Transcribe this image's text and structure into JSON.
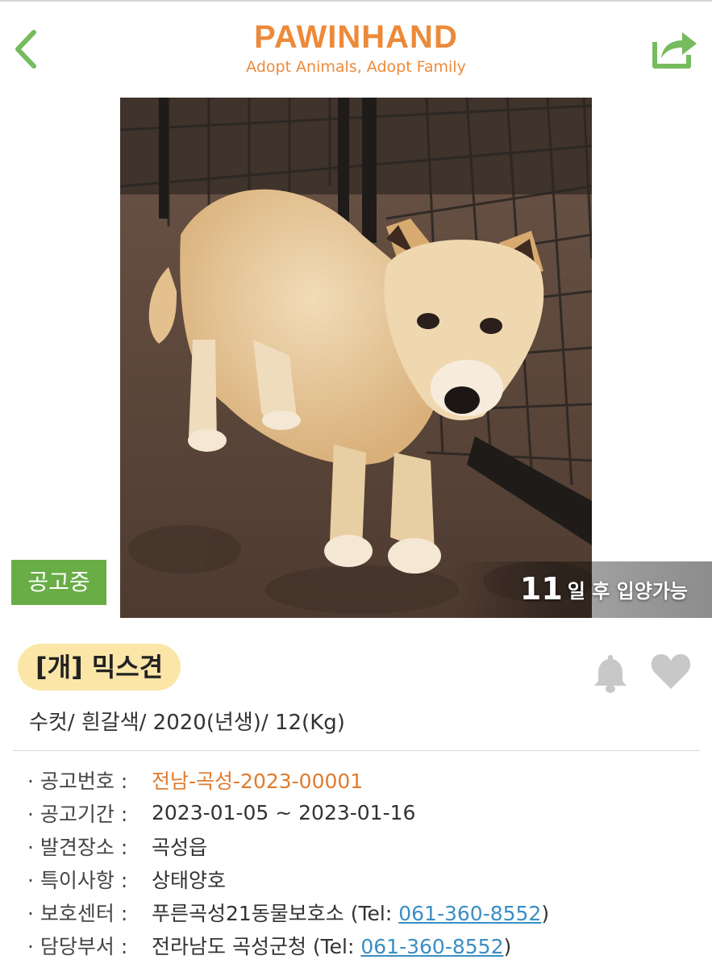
{
  "header": {
    "brand": "PAWINHAND",
    "tagline": "Adopt Animals, Adopt Family"
  },
  "colors": {
    "brand_orange": "#ec8a3a",
    "nav_green": "#76bb5e",
    "status_green": "#68ad46",
    "species_pill": "#fbe6a8",
    "link_blue": "#3a8ec4"
  },
  "icons": {
    "back": "chevron-left-icon",
    "share": "share-icon",
    "bell": "bell-icon",
    "heart": "heart-icon"
  },
  "photo": {
    "status_badge": "공고중",
    "adopt_days": "11",
    "adopt_label": "일 후 입양가능"
  },
  "animal": {
    "species_title": "[개] 믹스견",
    "summary": "수컷/ 흰갈색/ 2020(년생)/ 12(Kg)"
  },
  "info": {
    "notice_no_label": "· 공고번호 :",
    "notice_no": "전남-곡성-2023-00001",
    "period_label": "· 공고기간 :",
    "period": "2023-01-05 ~ 2023-01-16",
    "found_label": "· 발견장소 :",
    "found": "곡성읍",
    "notes_label": "· 특이사항 :",
    "notes": "상태양호",
    "shelter_label": "· 보호센터 :",
    "shelter_name": "푸른곡성21동물보호소 (Tel: ",
    "shelter_tel": "061-360-8552",
    "shelter_close": ")",
    "dept_label": "· 담당부서 :",
    "dept_name": "전라남도 곡성군청 (Tel: ",
    "dept_tel": "061-360-8552",
    "dept_close": ")"
  }
}
